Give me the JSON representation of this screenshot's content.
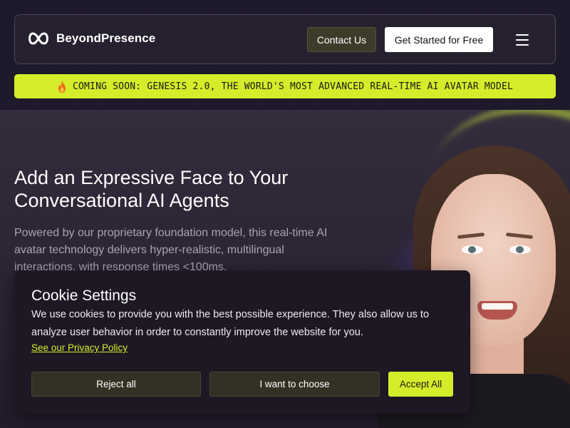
{
  "header": {
    "brand": "BeyondPresence",
    "contact_label": "Contact Us",
    "start_label": "Get Started for Free"
  },
  "banner": {
    "text": "COMING SOON: GENESIS 2.0, THE WORLD'S MOST ADVANCED REAL-TIME AI AVATAR MODEL"
  },
  "hero": {
    "title": "Add an Expressive Face to Your Conversational AI Agents",
    "subtitle": "Powered by our proprietary foundation model, this real-time AI avatar technology delivers hyper-realistic, multilingual interactions, with response times <100ms."
  },
  "cookie": {
    "title": "Cookie Settings",
    "text": "We use cookies to provide you with the best possible experience. They also allow us to analyze user behavior in order to constantly improve the website for you.",
    "link": "See our Privacy Policy",
    "reject_label": "Reject all",
    "choose_label": "I want to choose",
    "accept_label": "Accept All"
  },
  "icons": {
    "logo": "infinity-logo-icon",
    "menu": "hamburger-menu-icon",
    "banner": "fire-icon"
  },
  "colors": {
    "accent": "#d4ec2a",
    "background": "#17131f",
    "modal": "#1d1824"
  }
}
